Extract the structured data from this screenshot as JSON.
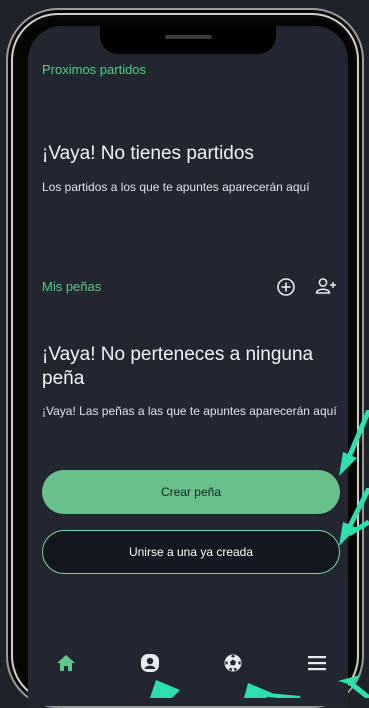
{
  "upcoming": {
    "section_title": "Proximos partidos",
    "empty_title": "¡Vaya! No tienes partidos",
    "empty_text": "Los partidos a los que te apuntes aparecerán aquí"
  },
  "groups": {
    "section_title": "Mis peñas",
    "add_icon": "plus-circle-icon",
    "join_icon": "user-plus-icon",
    "empty_title": "¡Vaya! No perteneces a ninguna peña",
    "empty_text": "¡Vaya! Las peñas a las que te apuntes aparecerán aquí",
    "create_button": "Crear peña",
    "join_button": "Unirse a una ya creada"
  },
  "bottom_nav": [
    {
      "icon": "home-icon",
      "active": true
    },
    {
      "icon": "profile-icon",
      "active": false
    },
    {
      "icon": "soccer-ball-icon",
      "active": false
    },
    {
      "icon": "menu-icon",
      "active": false
    }
  ],
  "colors": {
    "accent": "#5cc88a",
    "button_fill": "#68c08b",
    "screen_bg": "#212631",
    "page_bg": "#1e232b",
    "annotation_arrows": "#2ee0b0"
  }
}
